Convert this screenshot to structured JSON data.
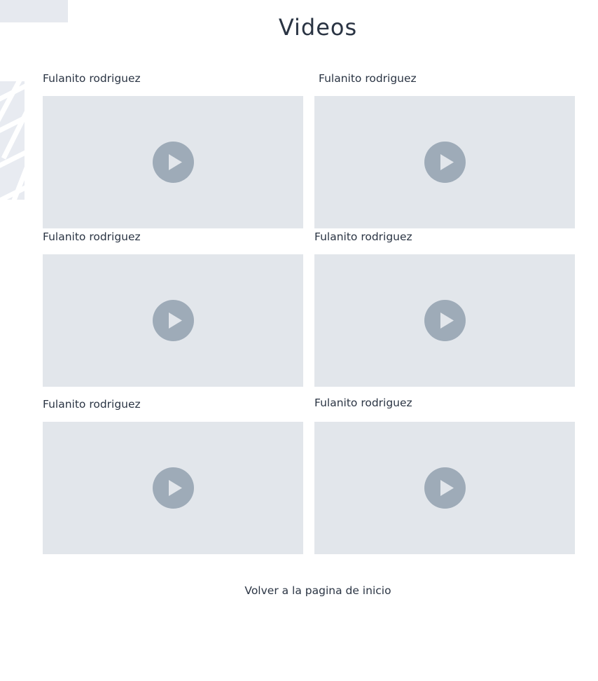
{
  "header": {
    "title": "Videos"
  },
  "videos": [
    {
      "author": "Fulanito rodriguez"
    },
    {
      "author": "Fulanito rodriguez"
    },
    {
      "author": "Fulanito rodriguez"
    },
    {
      "author": "Fulanito rodriguez"
    },
    {
      "author": "Fulanito rodriguez"
    },
    {
      "author": "Fulanito rodriguez"
    }
  ],
  "footer": {
    "back_link": "Volver a la pagina de inicio"
  },
  "icons": {
    "play": "play-icon"
  },
  "colors": {
    "text": "#2a3443",
    "thumb_bg": "#e2e6eb",
    "play_bg": "#9eabb8",
    "play_triangle": "#e2e6eb"
  }
}
